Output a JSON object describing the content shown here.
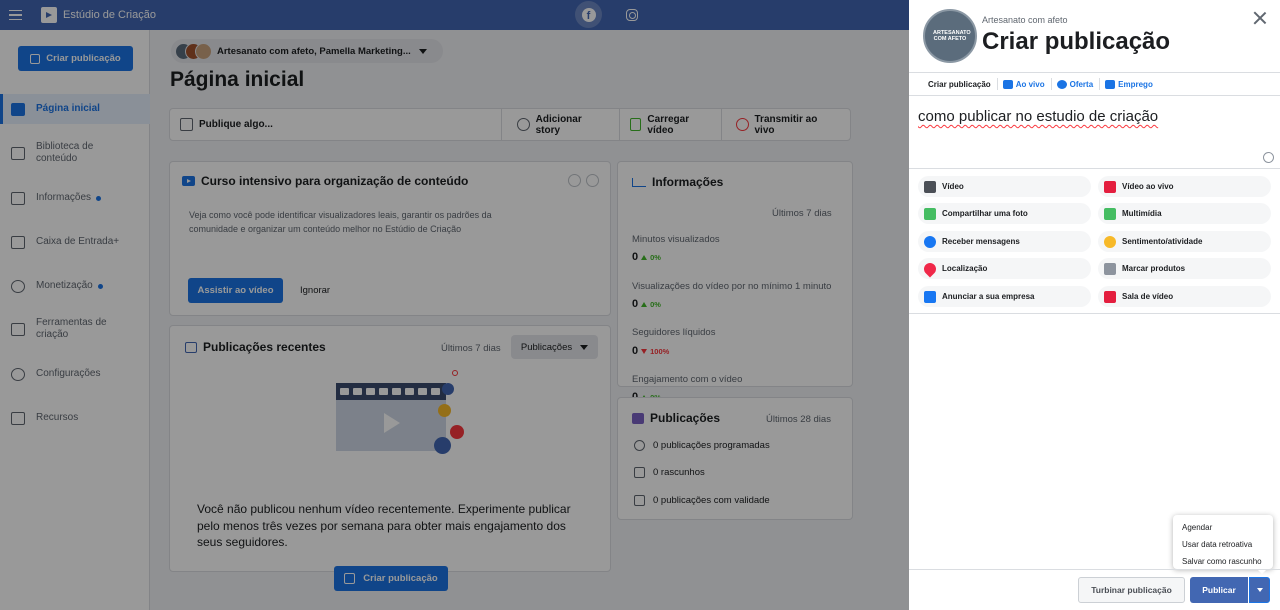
{
  "topbar": {
    "title": "Estúdio de Criação",
    "icons": [
      "hamburger-icon",
      "facebook-icon",
      "instagram-icon"
    ]
  },
  "sidebar": {
    "create_label": "Criar publicação",
    "items": [
      {
        "label": "Página inicial",
        "icon": "home-icon",
        "active": true
      },
      {
        "label": "Biblioteca de conteúdo",
        "icon": "library-icon"
      },
      {
        "label": "Informações",
        "icon": "insights-icon",
        "dot": true
      },
      {
        "label": "Caixa de Entrada+",
        "icon": "inbox-icon"
      },
      {
        "label": "Monetização",
        "icon": "dollar-icon",
        "dot": true
      },
      {
        "label": "Ferramentas de criação",
        "icon": "tools-icon"
      },
      {
        "label": "Configurações",
        "icon": "gear-icon"
      },
      {
        "label": "Recursos",
        "icon": "resources-icon"
      }
    ]
  },
  "main": {
    "page_selector": "Artesanato com afeto, Pamella Marketing...",
    "heading": "Página inicial",
    "actions": [
      "Publique algo...",
      "Adicionar story",
      "Carregar vídeo",
      "Transmitir ao vivo"
    ],
    "course": {
      "title": "Curso intensivo para organização de conteúdo",
      "desc": "Veja como você pode identificar visualizadores leais, garantir os padrões da comunidade e organizar um conteúdo melhor no Estúdio de Criação",
      "watch": "Assistir ao vídeo",
      "ignore": "Ignorar"
    },
    "recent": {
      "title": "Publicações recentes",
      "period": "Últimos 7 dias",
      "filter": "Publicações",
      "message": "Você não publicou nenhum vídeo recentemente. Experimente publicar pelo menos três vezes por semana para obter mais engajamento dos seus seguidores.",
      "create": "Criar publicação"
    },
    "info": {
      "title": "Informações",
      "period": "Últimos 7 dias",
      "metrics": [
        {
          "label": "Minutos visualizados",
          "value": "0",
          "change": "0%",
          "dir": "up"
        },
        {
          "label": "Visualizações do vídeo por no mínimo 1 minuto",
          "value": "0",
          "change": "0%",
          "dir": "up"
        },
        {
          "label": "Seguidores líquidos",
          "value": "0",
          "change": "100%",
          "dir": "down"
        },
        {
          "label": "Engajamento com o vídeo",
          "value": "0",
          "change": "0%",
          "dir": "up"
        }
      ]
    },
    "pubs": {
      "title": "Publicações",
      "period": "Últimos 28 dias",
      "rows": [
        "0 publicações programadas",
        "0 rascunhos",
        "0 publicações com validade"
      ]
    }
  },
  "panel": {
    "avatar_text": "ARTESANATO COM AFETO",
    "page_name": "Artesanato com afeto",
    "title": "Criar publicação",
    "tabs": [
      "Criar publicação",
      "Ao vivo",
      "Oferta",
      "Emprego"
    ],
    "text": "como publicar no estudio de criação",
    "options": [
      {
        "label": "Vídeo",
        "icon": "video-icon",
        "color": "#4b4f56"
      },
      {
        "label": "Vídeo ao vivo",
        "icon": "live-icon",
        "color": "#e41e3f"
      },
      {
        "label": "Compartilhar uma foto",
        "icon": "photo-icon",
        "color": "#45bd62"
      },
      {
        "label": "Multimídia",
        "icon": "multimedia-icon",
        "color": "#45bd62"
      },
      {
        "label": "Receber mensagens",
        "icon": "messenger-icon",
        "color": "#1877f2"
      },
      {
        "label": "Sentimento/atividade",
        "icon": "emoji-icon",
        "color": "#f7b928"
      },
      {
        "label": "Localização",
        "icon": "location-icon",
        "color": "#f02849"
      },
      {
        "label": "Marcar produtos",
        "icon": "tag-products-icon",
        "color": "#8d949e"
      },
      {
        "label": "Anunciar a sua empresa",
        "icon": "advertise-icon",
        "color": "#1877f2"
      },
      {
        "label": "Sala de vídeo",
        "icon": "watch-party-icon",
        "color": "#e41e3f"
      }
    ],
    "boost": "Turbinar publicação",
    "publish": "Publicar",
    "menu": [
      "Agendar",
      "Usar data retroativa",
      "Salvar como rascunho"
    ]
  }
}
